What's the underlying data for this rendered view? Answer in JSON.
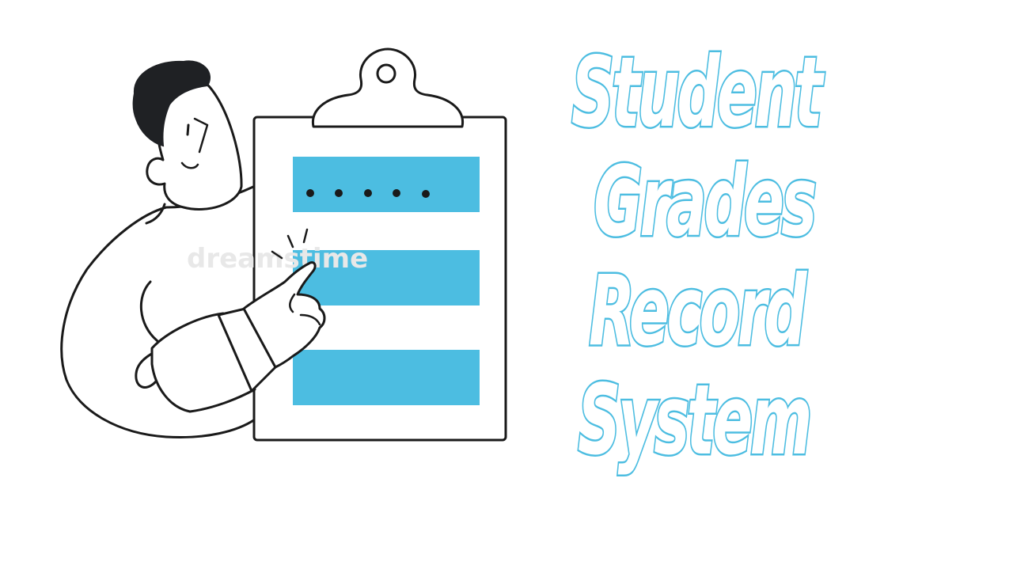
{
  "title": {
    "lines": [
      "Student",
      "Grades",
      "Record",
      "System"
    ]
  },
  "illustration": {
    "watermark": "dreamstime",
    "accent_color": "#4cbde1",
    "masked_field": "•••••",
    "icons": [
      "person-character",
      "clipboard-icon",
      "pointing-hand-icon"
    ]
  }
}
